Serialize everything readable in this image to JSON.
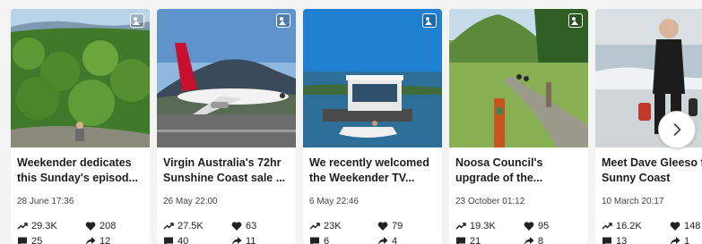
{
  "cards": [
    {
      "title": "Weekender dedicates this Sunday's episod...",
      "date": "28 June 17:36",
      "views": "29.3K",
      "likes": "208",
      "comments": "25",
      "shares": "12"
    },
    {
      "title": "Virgin Australia's 72hr Sunshine Coast sale ...",
      "date": "26 May 22:00",
      "views": "27.5K",
      "likes": "63",
      "comments": "40",
      "shares": "11"
    },
    {
      "title": "We recently welcomed the Weekender TV...",
      "date": "6 May 22:46",
      "views": "23K",
      "likes": "79",
      "comments": "6",
      "shares": "4"
    },
    {
      "title": "Noosa Council's upgrade of the...",
      "date": "23 October 01:12",
      "views": "19.3K",
      "likes": "95",
      "comments": "21",
      "shares": "8"
    },
    {
      "title": "Meet Dave Gleeso from Sunny Coast",
      "date": "10 March 20:17",
      "views": "16.2K",
      "likes": "148",
      "comments": "13",
      "shares": "1"
    }
  ],
  "icons": {
    "media_badge": "image-icon",
    "views": "trend-up-icon",
    "likes": "heart-icon",
    "comments": "comment-icon",
    "shares": "share-arrow-icon",
    "next": "chevron-right-icon"
  }
}
